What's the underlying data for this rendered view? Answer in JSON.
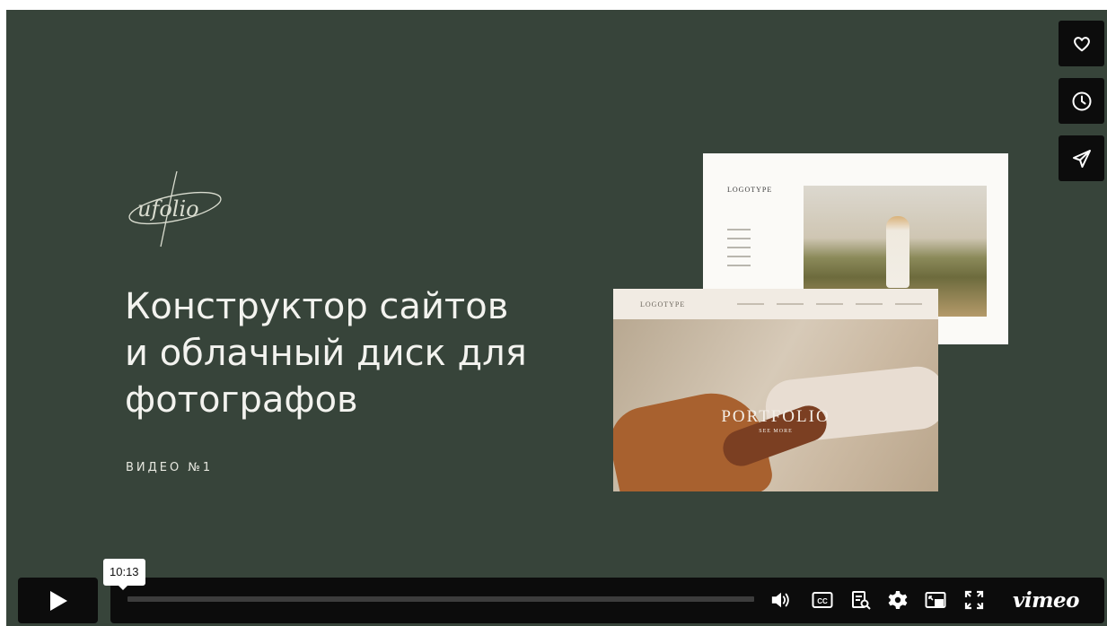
{
  "video": {
    "brand_logo": "ufolio",
    "headline_lines": [
      "Конструктор сайтов",
      "и облачный диск для",
      "фотографов"
    ],
    "episode_label": "ВИДЕО №1",
    "mockup_back_logo": "LOGOTYPE",
    "mockup_front_logo": "LOGOTYPE",
    "mockup_front_title": "PORTFOLIO",
    "mockup_front_subtitle": "SEE MORE"
  },
  "side_actions": [
    {
      "icon": "heart-icon"
    },
    {
      "icon": "clock-icon"
    },
    {
      "icon": "send-icon"
    }
  ],
  "controls": {
    "play_icon": "play-icon",
    "time_tooltip": "10:13",
    "progress_played_fraction": 0.0,
    "icons": [
      "volume-icon",
      "cc-icon",
      "transcript-icon",
      "settings-icon",
      "pip-icon",
      "fullscreen-icon"
    ],
    "brand": "vimeo"
  },
  "colors": {
    "background": "#37443a",
    "control_bg": "#0c0c0c"
  }
}
